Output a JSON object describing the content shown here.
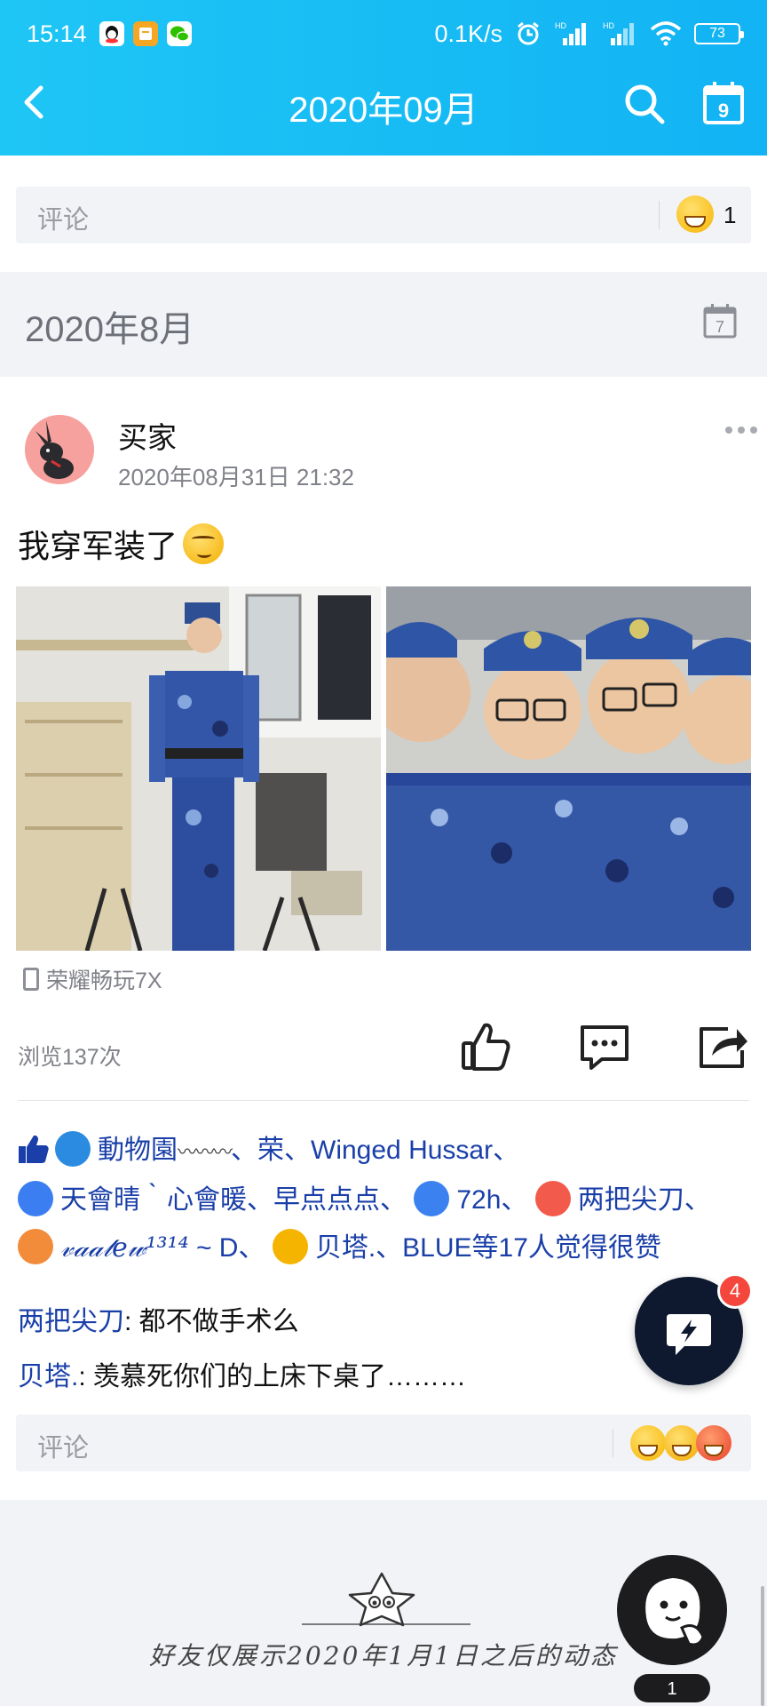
{
  "status_bar": {
    "time": "15:14",
    "net_speed": "0.1K/s",
    "battery": "73",
    "signal_label": "HD"
  },
  "nav": {
    "title": "2020年09月",
    "calendar_day": "9"
  },
  "prev_post": {
    "comment_placeholder": "评论",
    "reaction_count": "1"
  },
  "month_header": {
    "label": "2020年8月",
    "calendar_day": "7"
  },
  "post": {
    "username": "买家",
    "timestamp": "2020年08月31日 21:32",
    "text": "我穿军装了",
    "device": "荣耀畅玩7X",
    "views": "浏览137次",
    "likes": {
      "names_line1": [
        "動物園",
        "、荣、Winged Hussar、"
      ],
      "names_line2": [
        "天會晴｀心會暖、早点点点、",
        "72h、",
        "两把尖刀、"
      ],
      "names_line3_stylized": "𝓋𝒶𝒶𝓉𝑒𝓌¹³¹⁴",
      "names_line3_rest": "~ D、",
      "names_line3_end": "贝塔.、BLUE等17人觉得很赞"
    },
    "comments": [
      {
        "author": "两把尖刀",
        "sep": ": ",
        "text": "都不做手术么"
      },
      {
        "author": "贝塔.",
        "sep": ": ",
        "text": "羡慕死你们的上床下桌了………"
      }
    ],
    "comment_placeholder": "评论"
  },
  "fab": {
    "badge": "4"
  },
  "footer": {
    "text": "好友仅展示2020年1月1日之后的动态",
    "mascot_badge": "1"
  },
  "colors": {
    "header": "#12b3f4",
    "link_blue": "#1a3fa8",
    "background": "#f2f3f7",
    "badge_red": "#f4463c"
  }
}
